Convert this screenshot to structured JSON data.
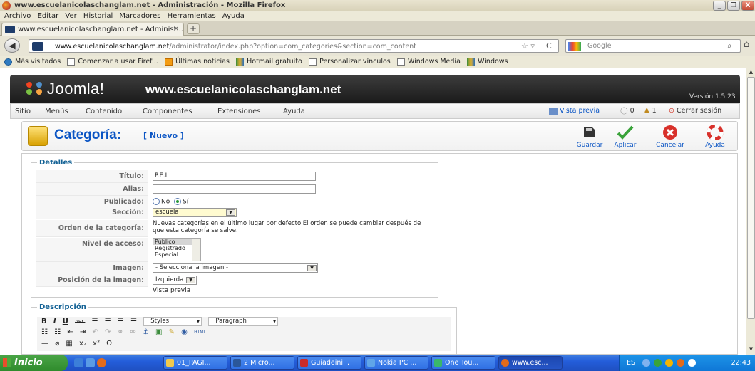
{
  "window": {
    "title": "www.escuelanicolaschanglam.net - Administración - Mozilla Firefox",
    "buttons": [
      "_",
      "❐",
      "X"
    ]
  },
  "menu": [
    "Archivo",
    "Editar",
    "Ver",
    "Historial",
    "Marcadores",
    "Herramientas",
    "Ayuda"
  ],
  "tab": {
    "label": "www.escuelanicolaschanglam.net - Administ...",
    "close": "×",
    "new": "+"
  },
  "nav": {
    "url_host": "www.escuelanicolaschanglam.net",
    "url_rest": "/administrator/index.php?option=com_categories&section=com_content",
    "search_placeholder": "Google"
  },
  "bookmarks": [
    "Más visitados",
    "Comenzar a usar Firef...",
    "Últimas noticias",
    "Hotmail gratuito",
    "Personalizar vínculos",
    "Windows Media",
    "Windows"
  ],
  "joomla": {
    "brand": "Joomla!",
    "site": "www.escuelanicolaschanglam.net",
    "version": "Versión 1.5.23"
  },
  "jmenu": [
    "Sitio",
    "Menús",
    "Contenido",
    "Componentes",
    "Extensiones",
    "Ayuda"
  ],
  "jmenu_right": {
    "preview": "Vista previa",
    "messages": "0",
    "users": "1",
    "logout": "Cerrar sesión"
  },
  "page": {
    "title": "Categoría:",
    "subtitle": "[ Nuevo ]"
  },
  "toolbar": {
    "save": "Guardar",
    "apply": "Aplicar",
    "cancel": "Cancelar",
    "help": "Ayuda"
  },
  "form": {
    "legend": "Detalles",
    "title_label": "Título:",
    "title_value": "P.E.I",
    "alias_label": "Alias:",
    "alias_value": "",
    "published_label": "Publicado:",
    "published_no": "No",
    "published_yes": "Sí",
    "published_value": "Sí",
    "section_label": "Sección:",
    "section_value": "escuela",
    "order_label": "Orden de la categoría:",
    "order_text": "Nuevas categorías en el último lugar por defecto.El orden se puede cambiar después de que esta categoría se salve.",
    "access_label": "Nivel de acceso:",
    "access_options": [
      "Público",
      "Registrado",
      "Especial"
    ],
    "access_selected": "Público",
    "image_label": "Imagen:",
    "image_value": "- Selecciona la imagen -",
    "image_pos_label": "Posición de la imagen:",
    "image_pos_value": "Izquierda",
    "preview_text": "Vista previa"
  },
  "description": {
    "legend": "Descripción",
    "styles": "Styles",
    "paragraph": "Paragraph",
    "row1_icons": [
      "B",
      "I",
      "U",
      "ABC"
    ],
    "html_label": "HTML",
    "omega": "Ω"
  },
  "taskbar": {
    "start": "Inicio",
    "items": [
      "01_PAGI...",
      "2 Micro...",
      "Guiadeini...",
      "Nokia PC ...",
      "One Tou...",
      "www.esc..."
    ],
    "lang": "ES",
    "clock": "22:43"
  },
  "colors": {
    "joomla_blue": "#0b55c4",
    "legend_blue": "#146295",
    "taskbar": "#245edb",
    "start_green": "#3c9a39"
  }
}
